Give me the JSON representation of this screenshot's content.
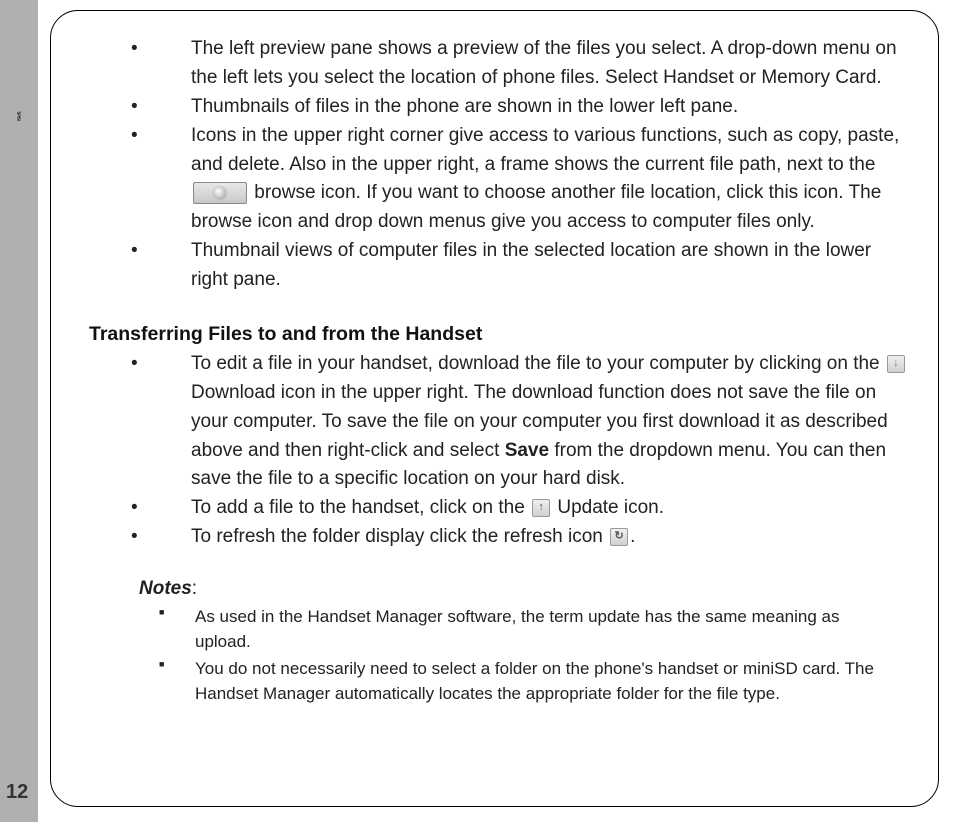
{
  "page_number": "12",
  "section1": {
    "items": [
      {
        "text": "The left preview pane shows a preview of the files you select. A drop-down menu on the left lets you select the location of phone files. Select Handset or Memory Card."
      },
      {
        "text": "Thumbnails of files in the phone are shown in the lower left pane."
      },
      {
        "pre_icon": "Icons in the upper right corner give access to various functions, such as copy, paste, and delete. Also in the upper right, a frame shows the current file path, next to the ",
        "post_icon": " browse icon. If you want to choose another file location, click this icon. The browse icon and drop down menus give you access to computer files only."
      },
      {
        "text": "Thumbnail views of computer files in the selected location are shown in the lower right pane."
      }
    ]
  },
  "section2": {
    "heading": "Transferring Files to and from the Handset",
    "items": [
      {
        "pre_icon": "To edit a file in your handset, download the file to your computer by clicking on the ",
        "mid1": " Download icon in the upper right. The download function does not save the file on your computer. To save the file on your computer you first download it as described above and then right-click and select ",
        "bold": "Save",
        "post_bold": " from the dropdown menu. You can then save the file to a specific location on your hard disk."
      },
      {
        "pre_icon": "To add a file to the handset,  click on the ",
        "post_icon": " Update icon."
      },
      {
        "pre_icon": "To refresh the folder display click the refresh icon ",
        "post_icon": "."
      }
    ]
  },
  "notes": {
    "label": "Notes",
    "colon": ":",
    "items": [
      "As used in the Handset Manager software, the term update has the same meaning as upload.",
      "You do not necessarily need to select a folder on the phone's handset or miniSD card. The Handset Manager automatically locates the appropriate folder for the file type."
    ]
  }
}
